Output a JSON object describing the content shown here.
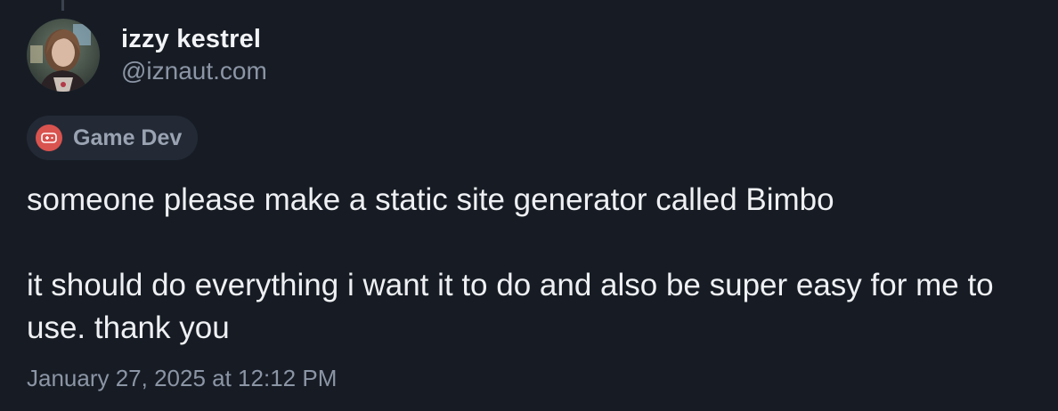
{
  "author": {
    "display_name": "izzy kestrel",
    "handle": "@iznaut.com"
  },
  "tag": {
    "label": "Game Dev",
    "icon": "gamepad-icon",
    "color": "#d9534f"
  },
  "post": {
    "paragraphs": [
      "someone please make a static site generator called Bimbo",
      "it should do everything i want it to do and also be super easy for me to use. thank you"
    ],
    "timestamp": "January 27, 2025 at 12:12 PM"
  },
  "colors": {
    "background": "#171c24",
    "tag_background": "#232a36",
    "muted_text": "#8b95a5"
  }
}
